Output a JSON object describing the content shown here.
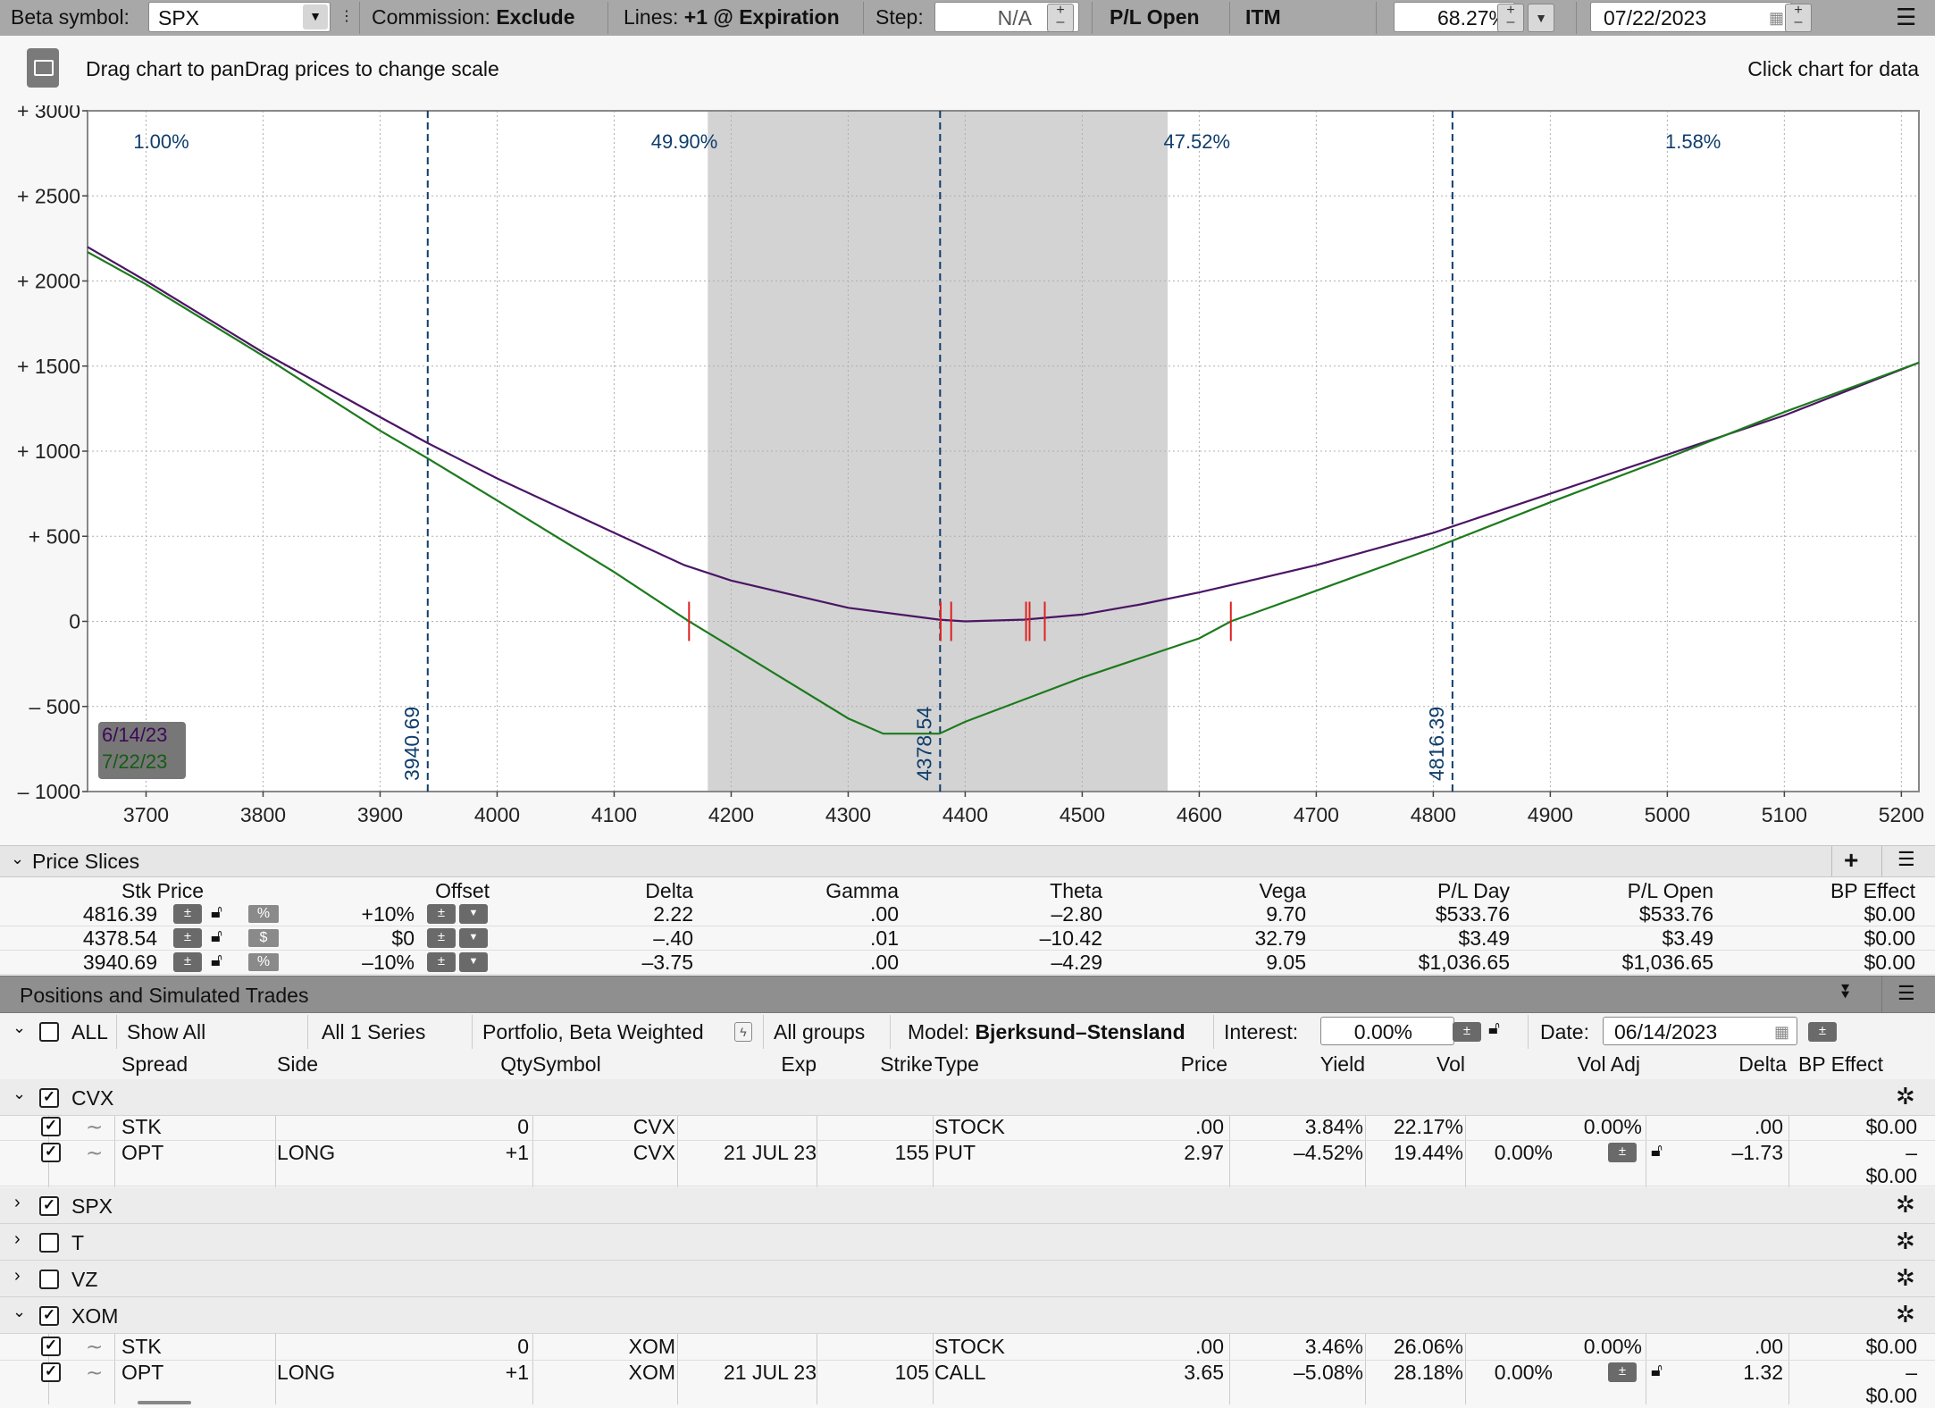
{
  "topbar": {
    "beta_label": "Beta symbol:",
    "beta_value": "SPX",
    "commission_label": "Commission:",
    "commission_value": "Exclude",
    "lines_label": "Lines:",
    "lines_value": "+1 @ Expiration",
    "step_label": "Step:",
    "step_value": "N/A",
    "pl_mode": "P/L Open",
    "itm": "ITM",
    "pct_value": "68.27%",
    "date_value": "07/22/2023"
  },
  "chart_toolbar": {
    "hint": "Drag chart to panDrag prices to change scale",
    "click_hint": "Click chart for data"
  },
  "chart_data": {
    "type": "line",
    "xlim": [
      3650,
      5215
    ],
    "ylim": [
      -1000,
      3000
    ],
    "x_ticks": [
      3700,
      3800,
      3900,
      4000,
      4100,
      4200,
      4300,
      4400,
      4500,
      4600,
      4700,
      4800,
      4900,
      5000,
      5100,
      5200
    ],
    "y_ticks": [
      -1000,
      -500,
      0,
      500,
      1000,
      1500,
      2000,
      2500,
      3000
    ],
    "y_tick_labels": [
      "– 1000",
      "– 500",
      "0",
      "+ 500",
      "+ 1000",
      "+ 1500",
      "+ 2000",
      "+ 2500",
      "+ 3000"
    ],
    "grid": true,
    "shaded_range": [
      4180,
      4573
    ],
    "vertical_markers": [
      {
        "x": 3940.69,
        "label": "3940.69"
      },
      {
        "x": 4378.54,
        "label": "4378.54"
      },
      {
        "x": 4816.39,
        "label": "4816.39"
      }
    ],
    "probabilities": [
      {
        "x": 3713,
        "label": "1.00%"
      },
      {
        "x": 4160,
        "label": "49.90%"
      },
      {
        "x": 4598,
        "label": "47.52%"
      },
      {
        "x": 5022,
        "label": "1.58%"
      }
    ],
    "red_ticks": [
      4164,
      4379,
      4388,
      4452,
      4455,
      4468,
      4627
    ],
    "series": [
      {
        "name": "6/14/23",
        "color": "#4b1565",
        "x": [
          3650,
          3700,
          3800,
          3900,
          3940,
          4000,
          4100,
          4160,
          4200,
          4300,
          4378,
          4400,
          4450,
          4500,
          4550,
          4600,
          4650,
          4700,
          4800,
          4900,
          5000,
          5100,
          5215
        ],
        "values": [
          2200,
          2000,
          1580,
          1200,
          1050,
          840,
          520,
          330,
          240,
          80,
          10,
          0,
          10,
          40,
          100,
          170,
          250,
          330,
          520,
          750,
          980,
          1210,
          1520
        ]
      },
      {
        "name": "7/22/23",
        "color": "#1d7a1d",
        "x": [
          3650,
          3700,
          3800,
          3900,
          3940,
          4000,
          4100,
          4164,
          4200,
          4300,
          4330,
          4378,
          4400,
          4500,
          4600,
          4627,
          4700,
          4800,
          4900,
          5000,
          5100,
          5215
        ],
        "values": [
          2170,
          1980,
          1560,
          1120,
          960,
          710,
          290,
          0,
          -150,
          -570,
          -660,
          -660,
          -590,
          -330,
          -100,
          0,
          180,
          430,
          700,
          960,
          1230,
          1520
        ]
      }
    ]
  },
  "price_slices": {
    "title": "Price Slices",
    "headers": [
      "Stk Price",
      "Offset",
      "Delta",
      "Gamma",
      "Theta",
      "Vega",
      "P/L Day",
      "P/L Open",
      "BP Effect"
    ],
    "rows": [
      {
        "stk": "4816.39",
        "unit": "%",
        "offset": "+10%",
        "delta": "2.22",
        "gamma": ".00",
        "theta": "–2.80",
        "vega": "9.70",
        "pl_day": "$533.76",
        "pl_open": "$533.76",
        "bp": "$0.00"
      },
      {
        "stk": "4378.54",
        "unit": "$",
        "offset": "$0",
        "delta": "–.40",
        "gamma": ".01",
        "theta": "–10.42",
        "vega": "32.79",
        "pl_day": "$3.49",
        "pl_open": "$3.49",
        "bp": "$0.00"
      },
      {
        "stk": "3940.69",
        "unit": "%",
        "offset": "–10%",
        "delta": "–3.75",
        "gamma": ".00",
        "theta": "–4.29",
        "vega": "9.05",
        "pl_day": "$1,036.65",
        "pl_open": "$1,036.65",
        "bp": "$0.00"
      }
    ]
  },
  "positions": {
    "title": "Positions and Simulated Trades",
    "filter_all": "ALL",
    "show_all": "Show All",
    "series": "All 1 Series",
    "portfolio": "Portfolio, Beta Weighted",
    "groups": "All groups",
    "model_label": "Model:",
    "model_value": "Bjerksund–Stensland",
    "interest_label": "Interest:",
    "interest_value": "0.00%",
    "date_label": "Date:",
    "date_value": "06/14/2023",
    "headers": [
      "Spread",
      "Side",
      "Qty",
      "Symbol",
      "Exp",
      "Strike",
      "Type",
      "Price",
      "Yield",
      "Vol",
      "Vol Adj",
      "Delta",
      "BP Effect"
    ],
    "groups_list": [
      {
        "name": "CVX",
        "checked": true,
        "expanded": true
      },
      {
        "name": "SPX",
        "checked": true,
        "expanded": false
      },
      {
        "name": "T",
        "checked": false,
        "expanded": false
      },
      {
        "name": "VZ",
        "checked": false,
        "expanded": false
      },
      {
        "name": "XOM",
        "checked": true,
        "expanded": true
      }
    ],
    "cvx_rows": [
      {
        "spread": "STK",
        "side": "",
        "qty": "0",
        "symbol": "CVX",
        "exp": "",
        "strike": "",
        "type": "STOCK",
        "price": ".00",
        "yield": "3.84%",
        "vol": "22.17%",
        "vol_adj": "0.00%",
        "delta": ".00",
        "bp": "$0.00",
        "bp2": ""
      },
      {
        "spread": "OPT",
        "side": "LONG",
        "qty": "+1",
        "symbol": "CVX",
        "exp": "21 JUL 23",
        "strike": "155",
        "type": "PUT",
        "price": "2.97",
        "yield": "–4.52%",
        "vol": "19.44%",
        "vol_adj": "0.00%",
        "delta": "–1.73",
        "bp": "–",
        "bp2": "$0.00"
      }
    ],
    "xom_rows": [
      {
        "spread": "STK",
        "side": "",
        "qty": "0",
        "symbol": "XOM",
        "exp": "",
        "strike": "",
        "type": "STOCK",
        "price": ".00",
        "yield": "3.46%",
        "vol": "26.06%",
        "vol_adj": "0.00%",
        "delta": ".00",
        "bp": "$0.00",
        "bp2": ""
      },
      {
        "spread": "OPT",
        "side": "LONG",
        "qty": "+1",
        "symbol": "XOM",
        "exp": "21 JUL 23",
        "strike": "105",
        "type": "CALL",
        "price": "3.65",
        "yield": "–5.08%",
        "vol": "28.18%",
        "vol_adj": "0.00%",
        "delta": "1.32",
        "bp": "–",
        "bp2": "$0.00"
      }
    ]
  }
}
